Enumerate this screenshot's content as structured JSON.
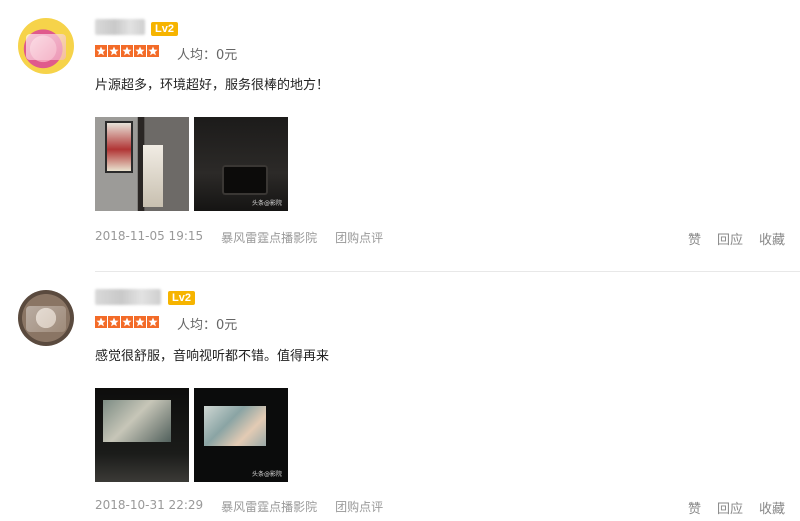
{
  "colors": {
    "star": "#f36b28",
    "level_badge": "#f6b400",
    "meta_text": "#999999"
  },
  "reviews": [
    {
      "level": "Lv2",
      "avg_price": "人均：0元",
      "rating_stars": 5,
      "text": "片源超多，环境超好，服务很棒的地方！",
      "photo_watermark": "头条@影院",
      "date": "2018-11-05 19:15",
      "shop": "暴风雷霆点播影院",
      "source": "团购点评",
      "actions": {
        "like": "赞",
        "reply": "回应",
        "favorite": "收藏"
      }
    },
    {
      "level": "Lv2",
      "avg_price": "人均：0元",
      "rating_stars": 5,
      "text": "感觉很舒服，音响视听都不错。值得再来",
      "photo_watermark": "头条@影院",
      "date": "2018-10-31 22:29",
      "shop": "暴风雷霆点播影院",
      "source": "团购点评",
      "actions": {
        "like": "赞",
        "reply": "回应",
        "favorite": "收藏"
      }
    }
  ]
}
